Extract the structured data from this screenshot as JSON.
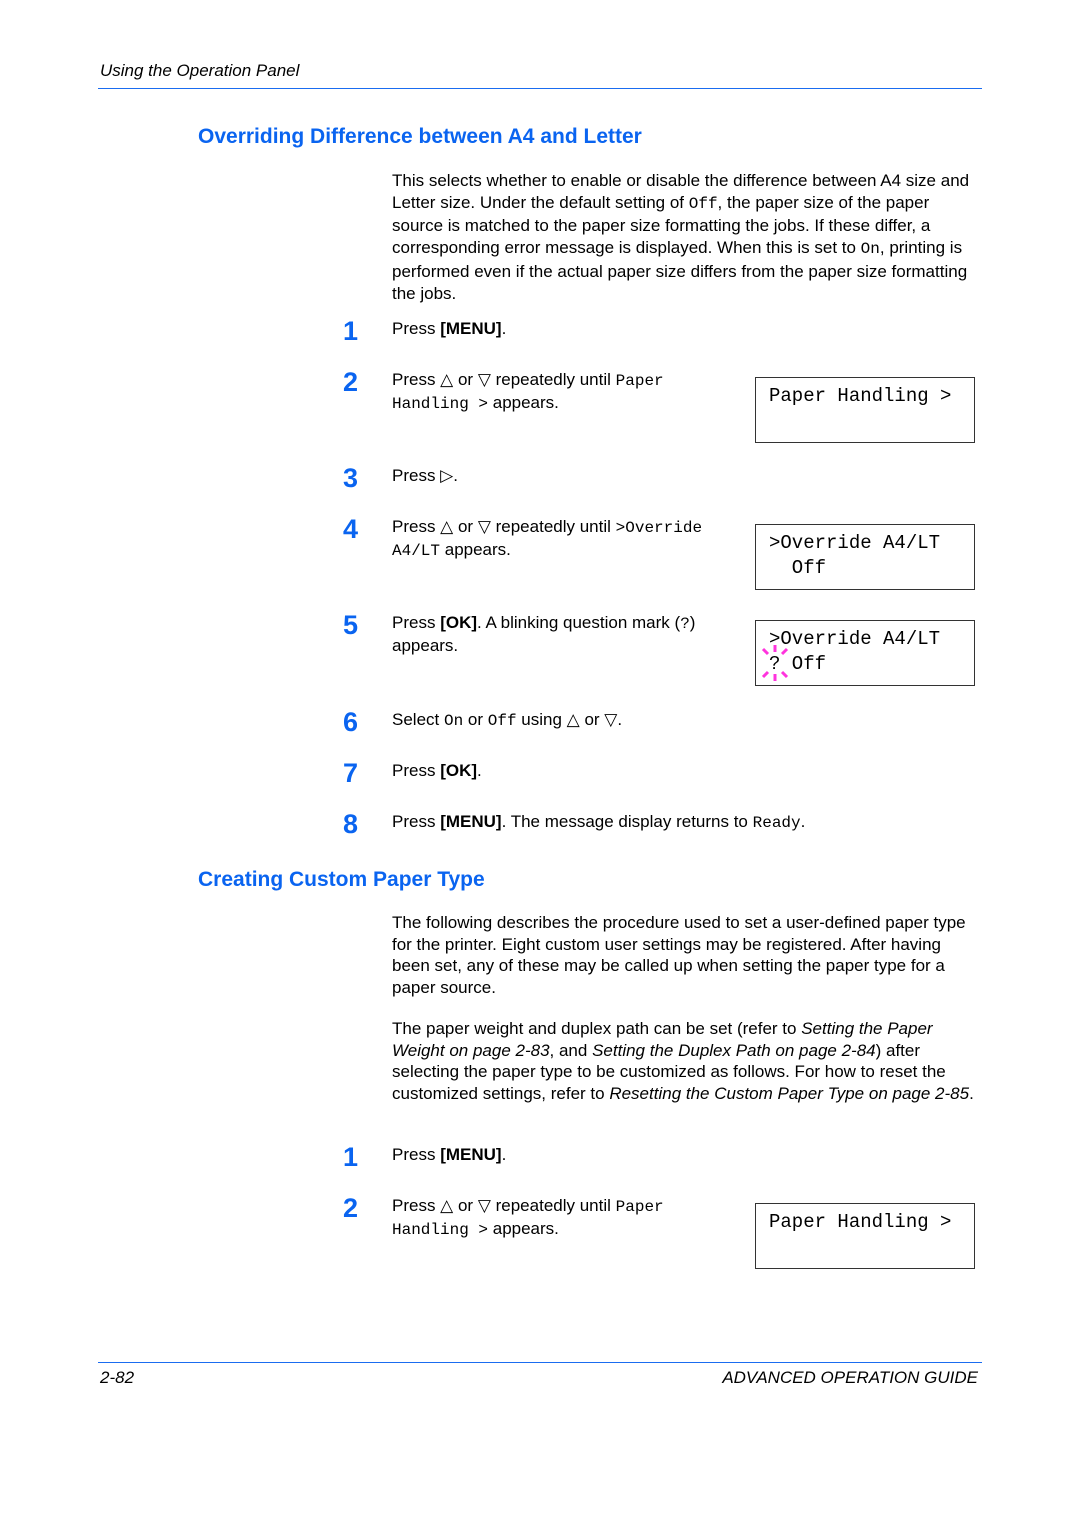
{
  "header": {
    "title": "Using the Operation Panel"
  },
  "section1": {
    "title": "Overriding Difference between A4 and Letter",
    "intro": [
      {
        "t": "This selects whether to enable or disable the difference between A4 size and Letter size. Under the default setting of "
      },
      {
        "t": "Off",
        "s": "mono"
      },
      {
        "t": ", the paper size of the paper source is matched to the paper size formatting the jobs. If these differ, a corresponding error message is displayed. When this is set to "
      },
      {
        "t": "On",
        "s": "mono"
      },
      {
        "t": ", printing is performed even if the actual paper size differs from the paper size formatting the jobs."
      }
    ],
    "steps": [
      {
        "n": "1",
        "seg": [
          {
            "t": "Press "
          },
          {
            "t": "[MENU]",
            "s": "b"
          },
          {
            "t": "."
          }
        ]
      },
      {
        "n": "2",
        "seg": [
          {
            "t": "Press △ or ▽ repeatedly until "
          },
          {
            "t": "Paper Handling >",
            "s": "mono"
          },
          {
            "t": " appears."
          }
        ],
        "lcd": [
          "Paper Handling >",
          ""
        ]
      },
      {
        "n": "3",
        "seg": [
          {
            "t": "Press ▷."
          }
        ]
      },
      {
        "n": "4",
        "seg": [
          {
            "t": "Press △ or ▽ repeatedly until "
          },
          {
            "t": ">Override A4/LT",
            "s": "mono"
          },
          {
            "t": " appears."
          }
        ],
        "lcd": [
          ">Override A4/LT",
          "  Off"
        ]
      },
      {
        "n": "5",
        "seg": [
          {
            "t": "Press "
          },
          {
            "t": "[OK]",
            "s": "b"
          },
          {
            "t": ". A blinking question mark ("
          },
          {
            "t": "?",
            "s": "mono"
          },
          {
            "t": ") appears."
          }
        ],
        "lcd": [
          ">Override A4/LT",
          "? Off"
        ],
        "blink": true
      },
      {
        "n": "6",
        "seg": [
          {
            "t": "Select "
          },
          {
            "t": "On",
            "s": "mono"
          },
          {
            "t": " or "
          },
          {
            "t": "Off",
            "s": "mono"
          },
          {
            "t": " using △ or ▽."
          }
        ]
      },
      {
        "n": "7",
        "seg": [
          {
            "t": "Press "
          },
          {
            "t": "[OK]",
            "s": "b"
          },
          {
            "t": "."
          }
        ]
      },
      {
        "n": "8",
        "seg": [
          {
            "t": "Press "
          },
          {
            "t": "[MENU]",
            "s": "b"
          },
          {
            "t": ". The message display returns to "
          },
          {
            "t": "Ready",
            "s": "mono"
          },
          {
            "t": "."
          }
        ]
      }
    ]
  },
  "section2": {
    "title": "Creating Custom Paper Type",
    "intro": [
      {
        "t": "The following describes the procedure used to set a user-defined paper type for the printer. Eight custom user settings may be registered. After having been set, any of these may be called up when setting the paper type for a paper source."
      }
    ],
    "intro2": [
      {
        "t": "The paper weight and duplex path can be set (refer to "
      },
      {
        "t": "Setting the Paper Weight on page 2-83",
        "s": "i"
      },
      {
        "t": ", and "
      },
      {
        "t": "Setting the Duplex Path on page 2-84",
        "s": "i"
      },
      {
        "t": ") after selecting the paper type to be customized as follows. For how to reset the customized settings, refer to "
      },
      {
        "t": "Resetting the Custom Paper Type on page 2-85",
        "s": "i"
      },
      {
        "t": "."
      }
    ],
    "steps": [
      {
        "n": "1",
        "seg": [
          {
            "t": "Press "
          },
          {
            "t": "[MENU]",
            "s": "b"
          },
          {
            "t": "."
          }
        ]
      },
      {
        "n": "2",
        "seg": [
          {
            "t": "Press △ or ▽ repeatedly until "
          },
          {
            "t": "Paper Handling >",
            "s": "mono"
          },
          {
            "t": " appears."
          }
        ],
        "lcd": [
          "Paper Handling >",
          ""
        ]
      }
    ]
  },
  "footer": {
    "page": "2-82",
    "guide": "ADVANCED OPERATION GUIDE"
  },
  "colors": {
    "accent": "#0a64f0",
    "blink": "#ff33dd"
  }
}
